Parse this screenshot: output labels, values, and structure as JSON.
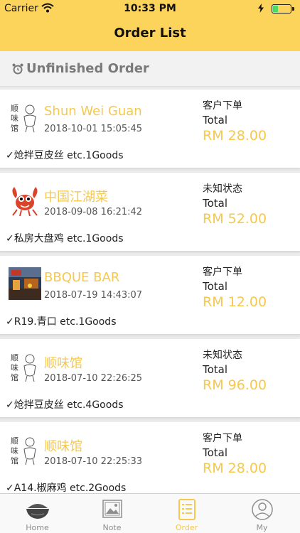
{
  "status_bar": {
    "carrier": "Carrier",
    "time": "10:33 PM",
    "battery_level": 0.3
  },
  "nav": {
    "title": "Order List"
  },
  "section": {
    "label": "Unfinished Order"
  },
  "orders": [
    {
      "shop": "Shun Wei Guan",
      "datetime": "2018-10-01 15:05:45",
      "goods": "✓炝拌豆皮丝 etc.1Goods",
      "status": "客户下单",
      "total_label": "Total",
      "amount": "RM 28.00",
      "thumb": "logo-sketch"
    },
    {
      "shop": "中国江湖菜",
      "datetime": "2018-09-08 16:21:42",
      "goods": "✓私房大盘鸡 etc.1Goods",
      "status": "未知状态",
      "total_label": "Total",
      "amount": "RM 52.00",
      "thumb": "crab-cartoon"
    },
    {
      "shop": "BBQUE BAR",
      "datetime": "2018-07-19 14:43:07",
      "goods": "✓R19.青口 etc.1Goods",
      "status": "客户下单",
      "total_label": "Total",
      "amount": "RM 12.00",
      "thumb": "street-photo"
    },
    {
      "shop": "顺味馆",
      "datetime": "2018-07-10 22:26:25",
      "goods": "✓炝拌豆皮丝 etc.4Goods",
      "status": "未知状态",
      "total_label": "Total",
      "amount": "RM 96.00",
      "thumb": "logo-sketch"
    },
    {
      "shop": "顺味馆",
      "datetime": "2018-07-10 22:25:33",
      "goods": "✓A14.椒麻鸡 etc.2Goods",
      "status": "客户下单",
      "total_label": "Total",
      "amount": "RM 28.00",
      "thumb": "logo-sketch"
    }
  ],
  "tabs": [
    {
      "label": "Home",
      "icon": "bowl-icon"
    },
    {
      "label": "Note",
      "icon": "gallery-icon"
    },
    {
      "label": "Order",
      "icon": "list-icon"
    },
    {
      "label": "My",
      "icon": "user-icon"
    }
  ],
  "colors": {
    "accent": "#fcd45c",
    "highlight_text": "#f6c84b",
    "background": "#ebebeb"
  }
}
